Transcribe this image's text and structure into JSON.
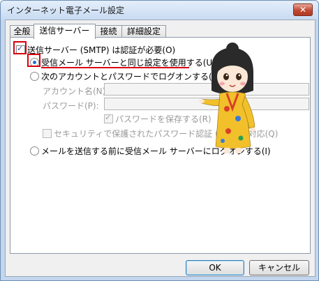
{
  "window": {
    "title": "インターネット電子メール設定",
    "close_label": "✕"
  },
  "tabs": [
    {
      "label": "全般"
    },
    {
      "label": "送信サーバー"
    },
    {
      "label": "接続"
    },
    {
      "label": "詳細設定"
    }
  ],
  "outgoing": {
    "requires_auth_label": "送信サーバー (SMTP) は認証が必要(O)",
    "requires_auth_checked": true,
    "same_as_incoming_label": "受信メール サーバーと同じ設定を使用する(U)",
    "same_as_incoming_selected": true,
    "logon_with_label": "次のアカウントとパスワードでログオンする(L)",
    "account_name_label": "アカウント名(N):",
    "account_name_value": "",
    "password_label": "パスワード(P):",
    "password_value": "",
    "save_password_label": "パスワードを保存する(R)",
    "save_password_checked": true,
    "spa_label": "セキュリティで保護されたパスワード認証 (SPA) に対応(Q)",
    "spa_checked": false,
    "logon_before_send_label": "メールを送信する前に受信メール サーバーにログオンする(I)"
  },
  "buttons": {
    "ok": "OK",
    "cancel": "キャンセル"
  },
  "colors": {
    "highlight": "#d8000f",
    "accent": "#2a6ad8"
  }
}
